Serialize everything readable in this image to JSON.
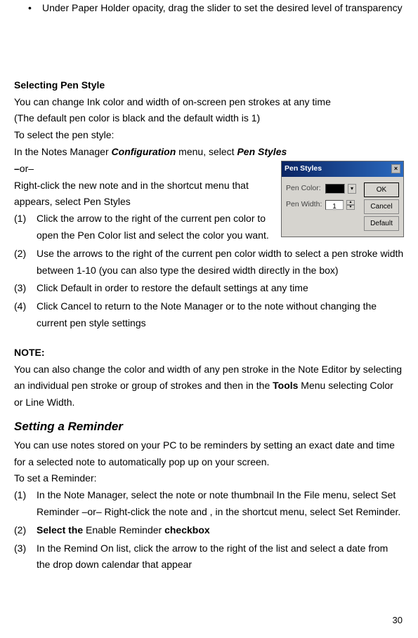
{
  "intro_bullet": "Under Paper Holder opacity, drag the slider to set the desired level of transparency",
  "sec1": {
    "title": "Selecting Pen Style",
    "p1": "You can change Ink color and width of on-screen pen strokes at any time",
    "p2": "(The default pen color is black and the default width is 1)",
    "p3": "To select the pen style:",
    "p4_pre": "In the Notes Manager ",
    "p4_bold1": "Configuration",
    "p4_mid": " menu, select ",
    "p4_bold2": "Pen Styles",
    "or": "–or–",
    "p5": "Right-click the new note and in the shortcut menu that appears, select Pen Styles",
    "steps": [
      {
        "n": "(1)",
        "t": "Click the arrow to the right of the current pen color to open the Pen Color list and select the color you want."
      },
      {
        "n": "(2)",
        "t": "Use the arrows to the right of the current pen color width to select a pen stroke width between 1-10 (you can also type the desired width directly in the box)"
      },
      {
        "n": "(3)",
        "t": "Click Default in order to restore the default settings at any time"
      },
      {
        "n": "(4)",
        "t": "Click Cancel to return to the Note Manager or to the note without changing the current pen style settings"
      }
    ]
  },
  "note": {
    "title": "NOTE:",
    "pre": "You can also change the color and width of any pen stroke in the Note Editor by selecting an individual pen stroke or group of strokes and then in the ",
    "bold": "Tools",
    "post": " Menu selecting Color or Line Width."
  },
  "sec2": {
    "title": "Setting a Reminder",
    "p1": "You can use notes stored on your PC to be reminders by setting an exact date and time for a selected note to automatically pop up on your screen.",
    "p2": "To set a Reminder:",
    "steps": [
      {
        "n": "(1)",
        "t": "In the Note Manager, select the note or note thumbnail In the File menu, select Set Reminder –or– Right-click the note and , in the shortcut menu, select Set Reminder."
      },
      {
        "n": "(2)",
        "pre": "Select the ",
        "mid": "Enable Reminder ",
        "post": "checkbox"
      },
      {
        "n": "(3)",
        "t": "In the Remind On list, click the arrow to the right of the list and select a date from the drop down calendar that appear"
      }
    ]
  },
  "dialog": {
    "title": "Pen Styles",
    "color_label": "Pen Color:",
    "width_label": "Pen Width:",
    "width_value": "1",
    "btn_ok": "OK",
    "btn_cancel": "Cancel",
    "btn_default": "Default"
  },
  "page_number": "30"
}
